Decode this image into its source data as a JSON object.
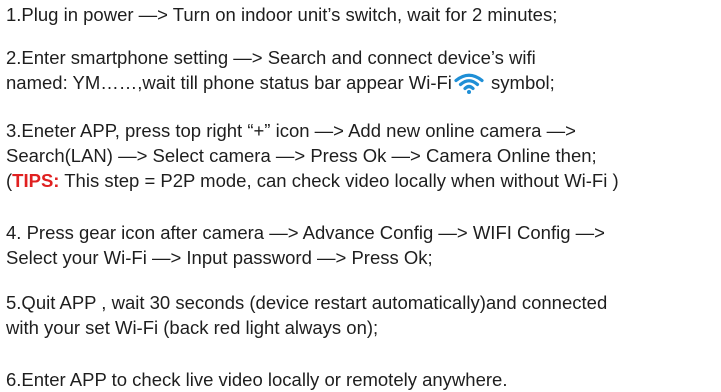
{
  "steps": [
    {
      "line1": "1.Plug in power —> Turn on indoor unit’s switch, wait for 2 minutes;"
    },
    {
      "line1": "2.Enter smartphone setting —> Search and connect device’s wifi",
      "line2_before_icon": "named: YM……,wait till phone status bar appear Wi-Fi",
      "line2_after_icon": " symbol;",
      "icon": "wifi-icon"
    },
    {
      "line1": "3.Eneter APP, press top right “+” icon —> Add new online camera —>",
      "line2": "Search(LAN)  —> Select camera —> Press Ok —> Camera Online then;",
      "line3_open": "(",
      "tips_label": "TIPS:",
      "line3_rest": " This step = P2P mode, can check video locally when without Wi-Fi )"
    },
    {
      "line1": "4. Press gear icon after camera —> Advance Config —> WIFI Config —>",
      "line2": "Select your Wi-Fi —> Input password —> Press Ok;"
    },
    {
      "line1": "5.Quit APP , wait 30 seconds (device restart automatically)and connected",
      "line2": "with your set Wi-Fi (back red light always on);"
    },
    {
      "line1": "6.Enter APP to check live video locally or remotely anywhere."
    }
  ],
  "colors": {
    "text": "#1e1e1e",
    "tips": "#e02020",
    "wifi_icon": "#1f8fd6"
  }
}
